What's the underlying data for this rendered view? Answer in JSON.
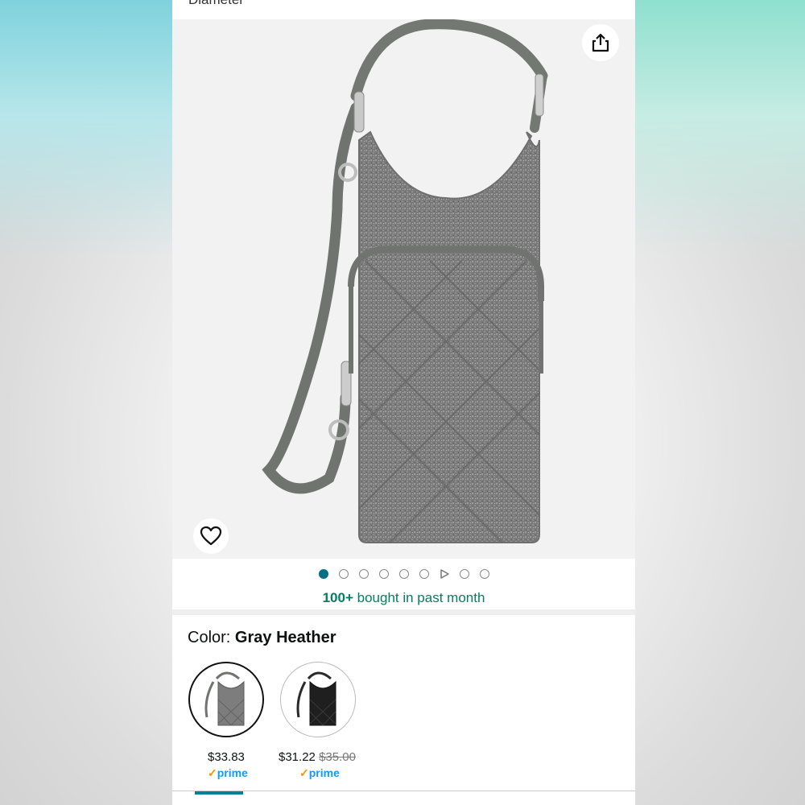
{
  "page": {
    "top_cut_text": "Diameter"
  },
  "gallery": {
    "share_icon": "share-icon",
    "favorite_icon": "heart-icon",
    "image_count": 9,
    "active_index": 0,
    "video_index": 6
  },
  "social_proof": {
    "count": "100+",
    "text": "bought in past month"
  },
  "color": {
    "label": "Color:",
    "value": "Gray Heather",
    "options": [
      {
        "price": "$33.83",
        "list_price": "",
        "prime": "prime",
        "selected": true,
        "swatch_color": "#7d7d7d"
      },
      {
        "price": "$31.22",
        "list_price": "$35.00",
        "prime": "prime",
        "selected": false,
        "swatch_color": "#1f1f1f"
      }
    ]
  },
  "colors": {
    "accent_teal": "#007185",
    "bought_green": "#067d62",
    "prime_blue": "#1399ff",
    "prime_orange": "#f79400"
  }
}
